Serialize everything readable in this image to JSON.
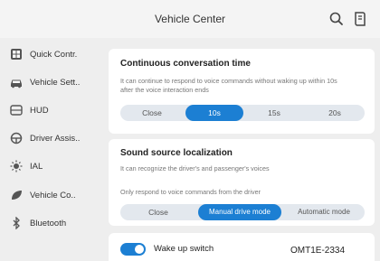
{
  "header": {
    "title": "Vehicle Center"
  },
  "sidebar": {
    "items": [
      {
        "label": "Quick Contr.",
        "icon": "grid-icon"
      },
      {
        "label": "Vehicle Sett..",
        "icon": "car-icon"
      },
      {
        "label": "HUD",
        "icon": "hud-icon"
      },
      {
        "label": "Driver Assis..",
        "icon": "steering-wheel-icon"
      },
      {
        "label": "IAL",
        "icon": "headlight-icon"
      },
      {
        "label": "Vehicle Co..",
        "icon": "leaf-icon"
      },
      {
        "label": "Bluetooth",
        "icon": "bluetooth-icon"
      }
    ]
  },
  "continuous_conversation": {
    "title": "Continuous conversation time",
    "description": "It can continue to respond to voice commands without waking up within 10s after the voice interaction ends",
    "options": [
      "Close",
      "10s",
      "15s",
      "20s"
    ],
    "selected": "10s"
  },
  "sound_source": {
    "title": "Sound source localization",
    "description": "It can recognize the driver's and passenger's voices",
    "note": "Only respond to voice commands from the driver",
    "options": [
      "Close",
      "Manual drive mode",
      "Automatic mode"
    ],
    "selected": "Manual drive mode"
  },
  "wake_up": {
    "label": "Wake up switch",
    "enabled": true
  },
  "watermark": "OMT1E-2334",
  "colors": {
    "accent": "#1c7fd3",
    "panel": "#eeeeee",
    "card": "#ffffff"
  }
}
